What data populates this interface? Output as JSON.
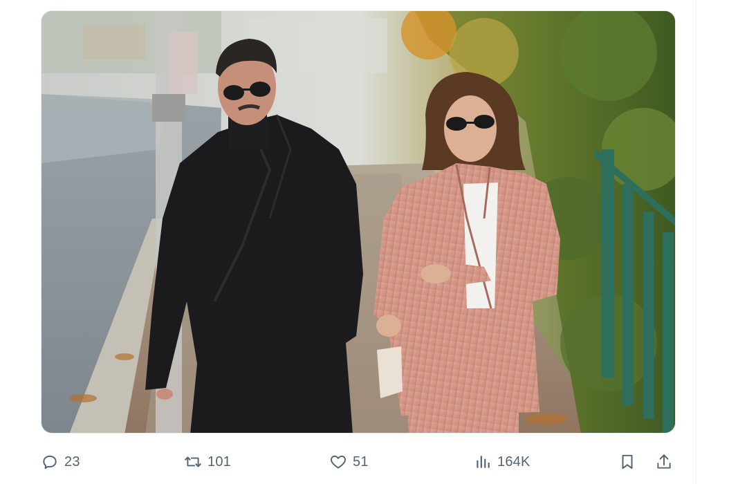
{
  "tweet": {
    "photo": {
      "description_icon": "photo-of-couple-walking-icon"
    },
    "actions": {
      "reply": {
        "icon": "reply-icon",
        "count": "23"
      },
      "retweet": {
        "icon": "retweet-icon",
        "count": "101"
      },
      "like": {
        "icon": "heart-icon",
        "count": "51"
      },
      "views": {
        "icon": "views-chart-icon",
        "count": "164K"
      },
      "bookmark": {
        "icon": "bookmark-icon"
      },
      "share": {
        "icon": "share-icon"
      }
    }
  },
  "colors": {
    "icon_gray": "#536471",
    "divider": "#eff3f4"
  }
}
